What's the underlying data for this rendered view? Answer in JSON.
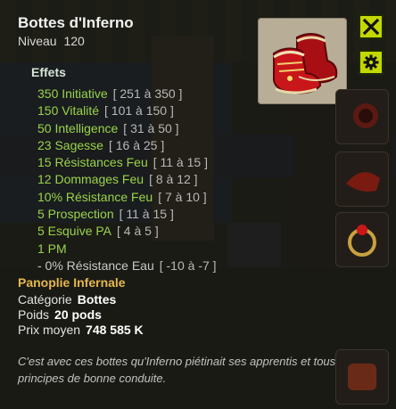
{
  "item": {
    "name": "Bottes d'Inferno",
    "level_label": "Niveau",
    "level": "120"
  },
  "effects": {
    "heading": "Effets",
    "list": [
      {
        "name": "350 Initiative",
        "range": "[ 251 à 350 ]",
        "negative": false
      },
      {
        "name": "150 Vitalité",
        "range": "[ 101 à 150 ]",
        "negative": false
      },
      {
        "name": "50 Intelligence",
        "range": "[ 31 à 50 ]",
        "negative": false
      },
      {
        "name": "23 Sagesse",
        "range": "[ 16 à 25 ]",
        "negative": false
      },
      {
        "name": "15 Résistances Feu",
        "range": "[ 11 à 15 ]",
        "negative": false
      },
      {
        "name": "12 Dommages Feu",
        "range": "[ 8 à 12 ]",
        "negative": false
      },
      {
        "name": "10% Résistance Feu",
        "range": "[ 7 à 10 ]",
        "negative": false
      },
      {
        "name": "5 Prospection",
        "range": "[ 11 à 15 ]",
        "negative": false
      },
      {
        "name": "5 Esquive PA",
        "range": "[ 4 à 5 ]",
        "negative": false
      },
      {
        "name": "1 PM",
        "range": "",
        "negative": false
      },
      {
        "name": "- 0% Résistance Eau",
        "range": "[ -10 à -7 ]",
        "negative": true
      }
    ]
  },
  "set": {
    "name": "Panoplie Infernale"
  },
  "meta": {
    "category_label": "Catégorie",
    "category": "Bottes",
    "weight_label": "Poids",
    "weight": "20 pods",
    "price_label": "Prix moyen",
    "price": "748 585 K"
  },
  "description": "C'est avec ces bottes qu'Inferno piétinait ses apprentis et tous les principes de bonne conduite.",
  "buttons": {
    "close_icon": "close-icon",
    "settings_icon": "gear-icon"
  },
  "colors": {
    "effect_green": "#9bd34a",
    "set_gold": "#e6b84a",
    "button_lime": "#c3d800",
    "boots_red": "#c8161a"
  }
}
